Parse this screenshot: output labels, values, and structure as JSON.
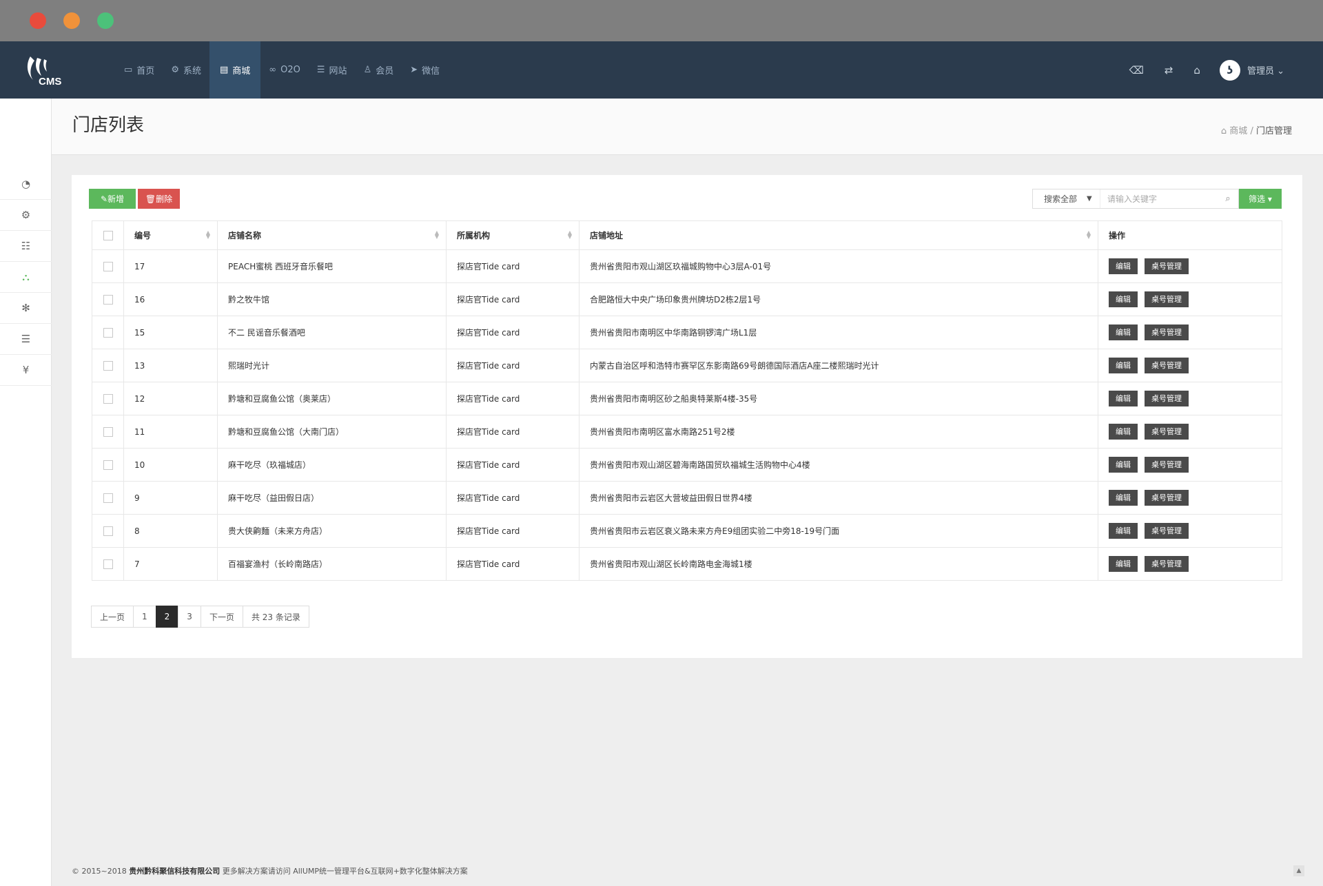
{
  "logo": {
    "text": "CMS"
  },
  "nav": {
    "items": [
      {
        "icon": "monitor-icon",
        "label": "首页"
      },
      {
        "icon": "gear-icon",
        "label": "系统"
      },
      {
        "icon": "shop-icon",
        "label": "商城"
      },
      {
        "icon": "o2o-icon",
        "label": "O2O"
      },
      {
        "icon": "database-icon",
        "label": "网站"
      },
      {
        "icon": "user-icon",
        "label": "会员"
      },
      {
        "icon": "send-icon",
        "label": "微信"
      }
    ],
    "active": "商城",
    "admin_label": "管理员"
  },
  "page": {
    "title": "门店列表",
    "breadcrumb": {
      "parent": "商城",
      "separator": "/",
      "current": "门店管理"
    }
  },
  "toolbar": {
    "add_label": "新增",
    "delete_label": "删除",
    "filter_label": "筛选",
    "search_scope": "搜索全部",
    "search_placeholder": "请输入关键字"
  },
  "table": {
    "headers": {
      "id": "编号",
      "name": "店铺名称",
      "org": "所属机构",
      "address": "店铺地址",
      "ops": "操作"
    },
    "edit_label": "编辑",
    "table_mgmt_label": "桌号管理",
    "rows": [
      {
        "id": "17",
        "name": "PEACH蜜桃 西班牙音乐餐吧",
        "org": "探店官Tide card",
        "address": "贵州省贵阳市观山湖区玖福城购物中心3层A-01号"
      },
      {
        "id": "16",
        "name": "黔之牧牛馆",
        "org": "探店官Tide card",
        "address": "合肥路恒大中央广场印象贵州牌坊D2栋2层1号"
      },
      {
        "id": "15",
        "name": "不二 民谣音乐餐酒吧",
        "org": "探店官Tide card",
        "address": "贵州省贵阳市南明区中华南路铜锣湾广场L1层"
      },
      {
        "id": "13",
        "name": "熙瑞时光计",
        "org": "探店官Tide card",
        "address": "内蒙古自治区呼和浩特市赛罕区东影南路69号朗德国际酒店A座二楼熙瑞时光计"
      },
      {
        "id": "12",
        "name": "黔塘和豆腐鱼公馆（奥莱店）",
        "org": "探店官Tide card",
        "address": "贵州省贵阳市南明区砂之船奥特莱斯4楼-35号"
      },
      {
        "id": "11",
        "name": "黔塘和豆腐鱼公馆（大南门店）",
        "org": "探店官Tide card",
        "address": "贵州省贵阳市南明区富水南路251号2楼"
      },
      {
        "id": "10",
        "name": "麻干吃尽（玖福城店）",
        "org": "探店官Tide card",
        "address": "贵州省贵阳市观山湖区碧海南路国贸玖福城生活购物中心4楼"
      },
      {
        "id": "9",
        "name": "麻干吃尽（益田假日店）",
        "org": "探店官Tide card",
        "address": "贵州省贵阳市云岩区大营坡益田假日世界4楼"
      },
      {
        "id": "8",
        "name": "贵大侠齁麵（未来方舟店）",
        "org": "探店官Tide card",
        "address": "贵州省贵阳市云岩区衰义路未来方舟E9组团实验二中旁18-19号门面"
      },
      {
        "id": "7",
        "name": "百福宴渔村（长岭南路店）",
        "org": "探店官Tide card",
        "address": "贵州省贵阳市观山湖区长岭南路电金海城1楼"
      }
    ]
  },
  "pagination": {
    "prev": "上一页",
    "pages": [
      "1",
      "2",
      "3"
    ],
    "current": "2",
    "next": "下一页",
    "total": "共 23 条记录"
  },
  "footer": {
    "copyright": "© 2015~2018",
    "company": "贵州黔科聚信科技有限公司",
    "text": "更多解决方案请访问 AllUMP统一管理平台&互联网+数字化整体解决方案"
  }
}
